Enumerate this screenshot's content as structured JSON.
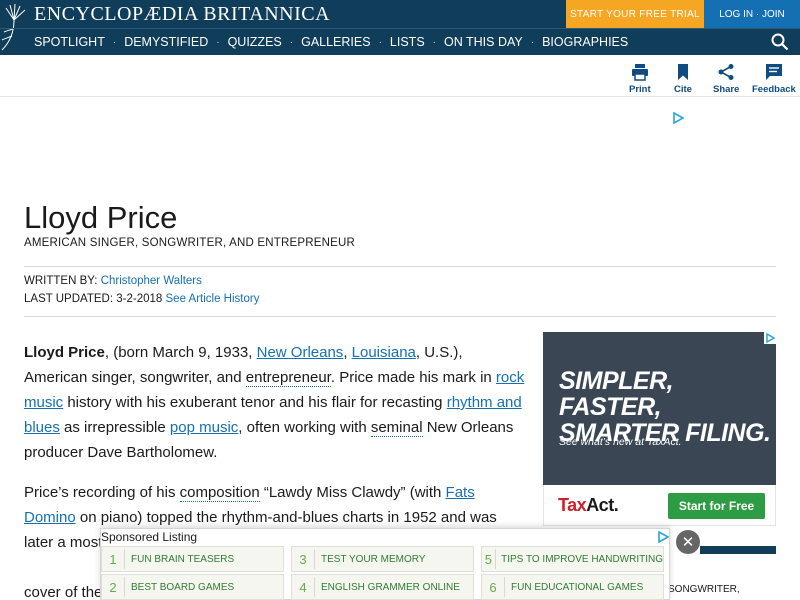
{
  "header": {
    "brand": "ENCYCLOPÆDIA BRITANNICA",
    "trial_button": "START YOUR FREE TRIAL",
    "login_button": "LOG IN · JOIN",
    "nav": [
      "SPOTLIGHT",
      "DEMYSTIFIED",
      "QUIZZES",
      "GALLERIES",
      "LISTS",
      "ON THIS DAY",
      "BIOGRAPHIES"
    ],
    "nav_separator": "·",
    "colors": {
      "bar": "#0f3d5a",
      "trial": "#f5a623",
      "login": "#1570b3"
    }
  },
  "toolbar": {
    "print": "Print",
    "cite": "Cite",
    "share": "Share",
    "feedback": "Feedback"
  },
  "article": {
    "title": "Lloyd Price",
    "subtitle": "AMERICAN SINGER, SONGWRITER, AND ENTREPRENEUR",
    "written_by_label": "WRITTEN BY:",
    "author": "Christopher Walters",
    "updated_label": "LAST UPDATED:",
    "updated_date": "3-2-2018",
    "history_link": "See Article History",
    "p1": {
      "name": "Lloyd Price",
      "t1": ", (born March 9, 1933, ",
      "l1": "New Orleans",
      "t2": ", ",
      "l2": "Louisiana",
      "t3": ", U.S.), American singer, songwriter, and ",
      "l3": "entrepreneur",
      "t4": ". Price made his mark in ",
      "l4": "rock",
      "t5": " ",
      "l5": "music",
      "t6": " history with his exuberant tenor and his flair for recasting ",
      "l6": "rhythm and blues",
      "t7": " as irrepressible ",
      "l7": "pop music",
      "t8": ", often working with ",
      "l8": "seminal",
      "t9": " New Orleans producer Dave Bartholomew."
    },
    "p2": {
      "t1": "Price’s recording of his ",
      "l1": "composition",
      "t2": " “Lawdy Miss Clawdy” (with ",
      "l2": "Fats Domino",
      "t3": " on piano) topped the rhythm-and-blues charts in 1952 and was later a",
      "t4": " most delig",
      "t5": ""
    },
    "p3": {
      "t1": "cover of the"
    }
  },
  "side_ad": {
    "headline": "SIMPLER, FASTER, SMARTER FILING.",
    "subtext": "See what’s new at TaxAct.",
    "logo_tax": "Tax",
    "logo_act": "Act.",
    "cta": "Start for Free"
  },
  "right_text": "SONGWRITER,",
  "sponsored": {
    "heading": "Sponsored Listing",
    "items": [
      {
        "num": "1",
        "label": "FUN BRAIN TEASERS"
      },
      {
        "num": "3",
        "label": "TEST YOUR MEMORY"
      },
      {
        "num": "5",
        "label": "TIPS TO IMPROVE HANDWRITING"
      },
      {
        "num": "2",
        "label": "BEST BOARD GAMES"
      },
      {
        "num": "4",
        "label": "ENGLISH GRAMMER ONLINE"
      },
      {
        "num": "6",
        "label": "FUN EDUCATIONAL GAMES"
      }
    ],
    "close": "✕"
  }
}
